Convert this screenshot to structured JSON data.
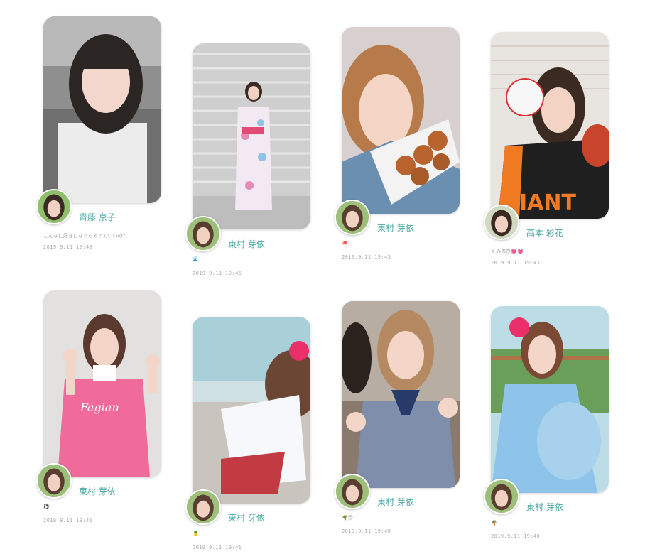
{
  "posts": [
    {
      "author": "齊藤 京子",
      "caption": "こんなに好きになっちゃっていいの？",
      "timestamp": "2019.9.11 19:48"
    },
    {
      "author": "東村 芽依",
      "caption": "🌊",
      "timestamp": "2019.9.11 19:45"
    },
    {
      "author": "東村 芽依",
      "caption": "🐙",
      "timestamp": "2019.9.11 19:43"
    },
    {
      "author": "高本 彩花",
      "caption": "くみのひ💓💓",
      "timestamp": "2019.9.11 19:43"
    },
    {
      "author": "東村 芽依",
      "caption": "⚽",
      "timestamp": "2019.9.11 19:41"
    },
    {
      "author": "東村 芽依",
      "caption": "🍍",
      "timestamp": "2019.9.11 19:41"
    },
    {
      "author": "東村 芽依",
      "caption": "🌴😊",
      "timestamp": "2019.9.11 19:40"
    },
    {
      "author": "東村 芽依",
      "caption": "🌴",
      "timestamp": "2019.9.11 19:40"
    }
  ],
  "colors": {
    "accent": "#4aa7a4",
    "meta": "#a8a8a8"
  }
}
